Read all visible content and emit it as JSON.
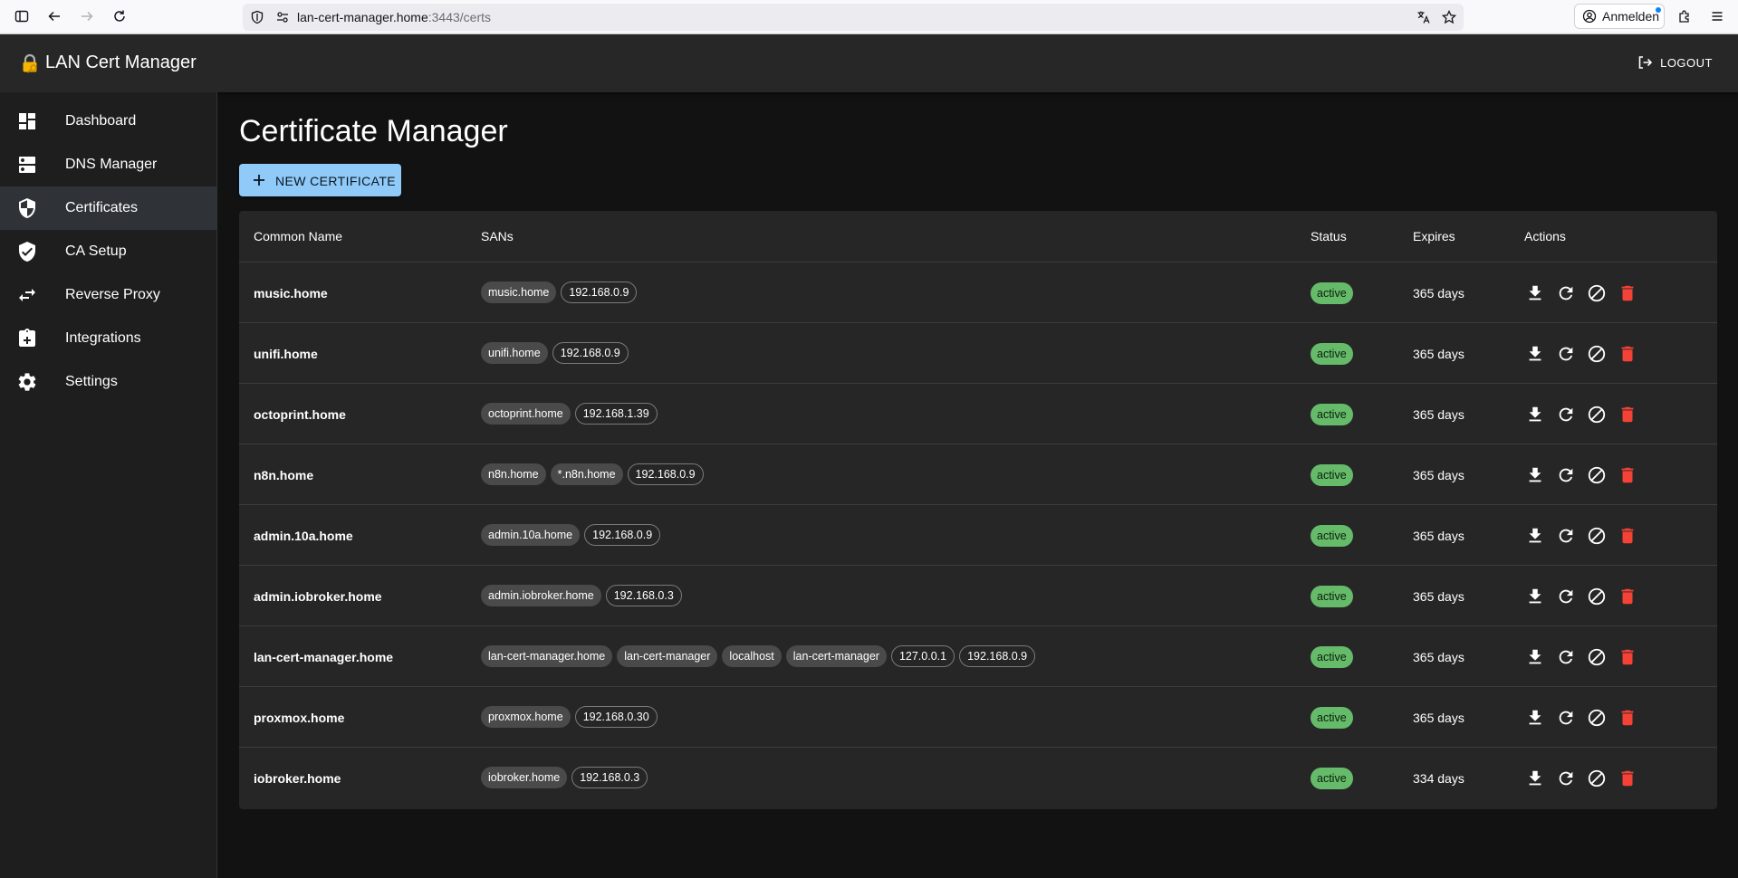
{
  "browser": {
    "url_host": "lan-cert-manager.home",
    "url_path": ":3443/certs",
    "signin_label": "Anmelden"
  },
  "app": {
    "title": "LAN Cert Manager",
    "logout_label": "LOGOUT"
  },
  "sidebar": {
    "items": [
      {
        "label": "Dashboard",
        "icon": "dashboard-icon"
      },
      {
        "label": "DNS Manager",
        "icon": "dns-icon"
      },
      {
        "label": "Certificates",
        "icon": "shield-icon",
        "active": true
      },
      {
        "label": "CA Setup",
        "icon": "verified-shield-icon"
      },
      {
        "label": "Reverse Proxy",
        "icon": "swap-arrows-icon"
      },
      {
        "label": "Integrations",
        "icon": "integration-icon"
      },
      {
        "label": "Settings",
        "icon": "gear-icon"
      }
    ]
  },
  "main": {
    "title": "Certificate Manager",
    "new_button_label": "NEW CERTIFICATE",
    "columns": [
      "Common Name",
      "SANs",
      "Status",
      "Expires",
      "Actions"
    ],
    "rows": [
      {
        "cn": "music.home",
        "sans": [
          {
            "t": "music.home",
            "k": "dns"
          },
          {
            "t": "192.168.0.9",
            "k": "ip"
          }
        ],
        "status": "active",
        "expires": "365 days"
      },
      {
        "cn": "unifi.home",
        "sans": [
          {
            "t": "unifi.home",
            "k": "dns"
          },
          {
            "t": "192.168.0.9",
            "k": "ip"
          }
        ],
        "status": "active",
        "expires": "365 days"
      },
      {
        "cn": "octoprint.home",
        "sans": [
          {
            "t": "octoprint.home",
            "k": "dns"
          },
          {
            "t": "192.168.1.39",
            "k": "ip"
          }
        ],
        "status": "active",
        "expires": "365 days"
      },
      {
        "cn": "n8n.home",
        "sans": [
          {
            "t": "n8n.home",
            "k": "dns"
          },
          {
            "t": "*.n8n.home",
            "k": "dns"
          },
          {
            "t": "192.168.0.9",
            "k": "ip"
          }
        ],
        "status": "active",
        "expires": "365 days"
      },
      {
        "cn": "admin.10a.home",
        "sans": [
          {
            "t": "admin.10a.home",
            "k": "dns"
          },
          {
            "t": "192.168.0.9",
            "k": "ip"
          }
        ],
        "status": "active",
        "expires": "365 days"
      },
      {
        "cn": "admin.iobroker.home",
        "sans": [
          {
            "t": "admin.iobroker.home",
            "k": "dns"
          },
          {
            "t": "192.168.0.3",
            "k": "ip"
          }
        ],
        "status": "active",
        "expires": "365 days"
      },
      {
        "cn": "lan-cert-manager.home",
        "sans": [
          {
            "t": "lan-cert-manager.home",
            "k": "dns"
          },
          {
            "t": "lan-cert-manager",
            "k": "dns"
          },
          {
            "t": "localhost",
            "k": "dns"
          },
          {
            "t": "lan-cert-manager",
            "k": "dns"
          },
          {
            "t": "127.0.0.1",
            "k": "ip"
          },
          {
            "t": "192.168.0.9",
            "k": "ip"
          }
        ],
        "status": "active",
        "expires": "365 days"
      },
      {
        "cn": "proxmox.home",
        "sans": [
          {
            "t": "proxmox.home",
            "k": "dns"
          },
          {
            "t": "192.168.0.30",
            "k": "ip"
          }
        ],
        "status": "active",
        "expires": "365 days"
      },
      {
        "cn": "iobroker.home",
        "sans": [
          {
            "t": "iobroker.home",
            "k": "dns"
          },
          {
            "t": "192.168.0.3",
            "k": "ip"
          }
        ],
        "status": "active",
        "expires": "334 days"
      }
    ],
    "actions": [
      {
        "name": "download-icon",
        "color": "#ffffff"
      },
      {
        "name": "renew-icon",
        "color": "#ffffff"
      },
      {
        "name": "revoke-icon",
        "color": "#ffffff"
      },
      {
        "name": "delete-icon",
        "color": "#f44336"
      }
    ]
  },
  "colors": {
    "accent": "#90caf9",
    "status_active": "#66bb6a",
    "danger": "#f44336"
  }
}
